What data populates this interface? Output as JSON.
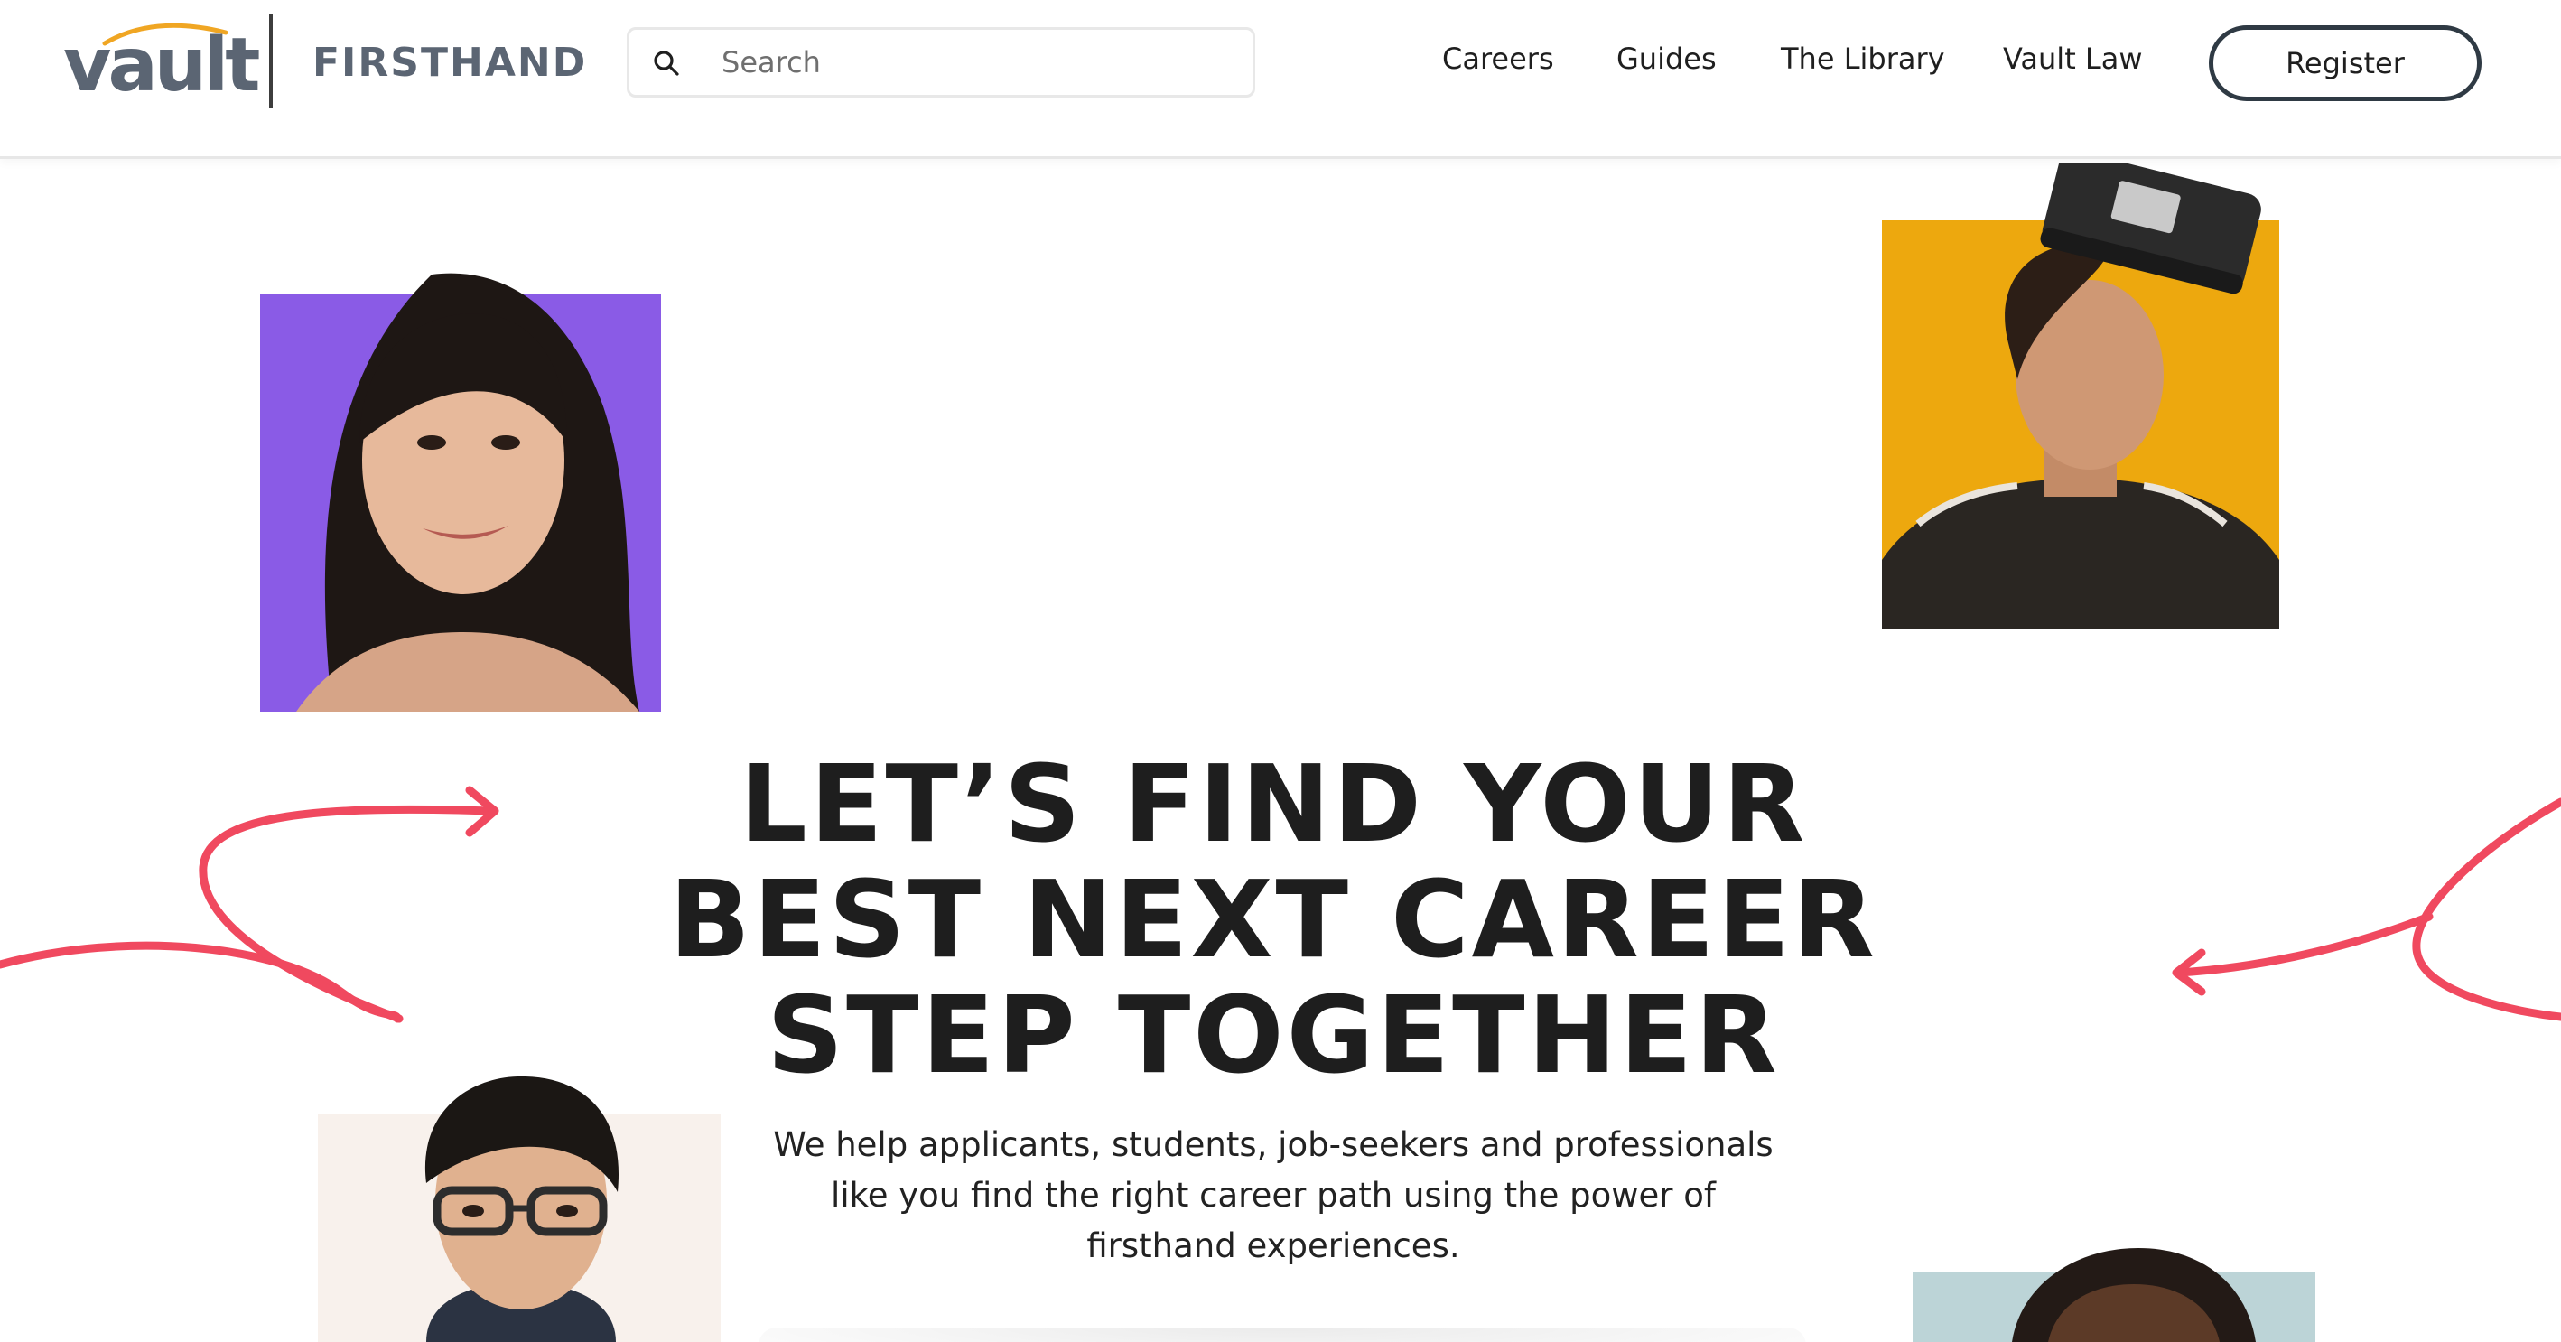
{
  "header": {
    "logo_primary": "vault",
    "logo_secondary": "FIRSTHAND",
    "search": {
      "placeholder": "Search",
      "value": ""
    },
    "nav": [
      {
        "label": "Careers"
      },
      {
        "label": "Guides"
      },
      {
        "label": "The Library"
      },
      {
        "label": "Vault Law"
      }
    ],
    "register_label": "Register"
  },
  "hero": {
    "title_lines": [
      "LET’S FIND YOUR",
      "BEST NEXT CAREER",
      "STEP TOGETHER"
    ],
    "subtitle_lines": [
      "We help applicants, students, job-seekers and professionals",
      "like you find the right career path using the power of",
      "firsthand experiences."
    ]
  },
  "colors": {
    "accent_arrow": "#f0495f",
    "logo_swoosh": "#f0a623",
    "logo_text": "#5b6573",
    "photo1_bg": "#8a5be6",
    "photo2_bg": "#eda80e",
    "photo3_bg": "#f8f1ec",
    "photo4_bg": "#bcd4d7",
    "register_border": "#2f3a44"
  },
  "icons": [
    "search-icon",
    "arrow-left-decoration",
    "arrow-right-decoration"
  ]
}
